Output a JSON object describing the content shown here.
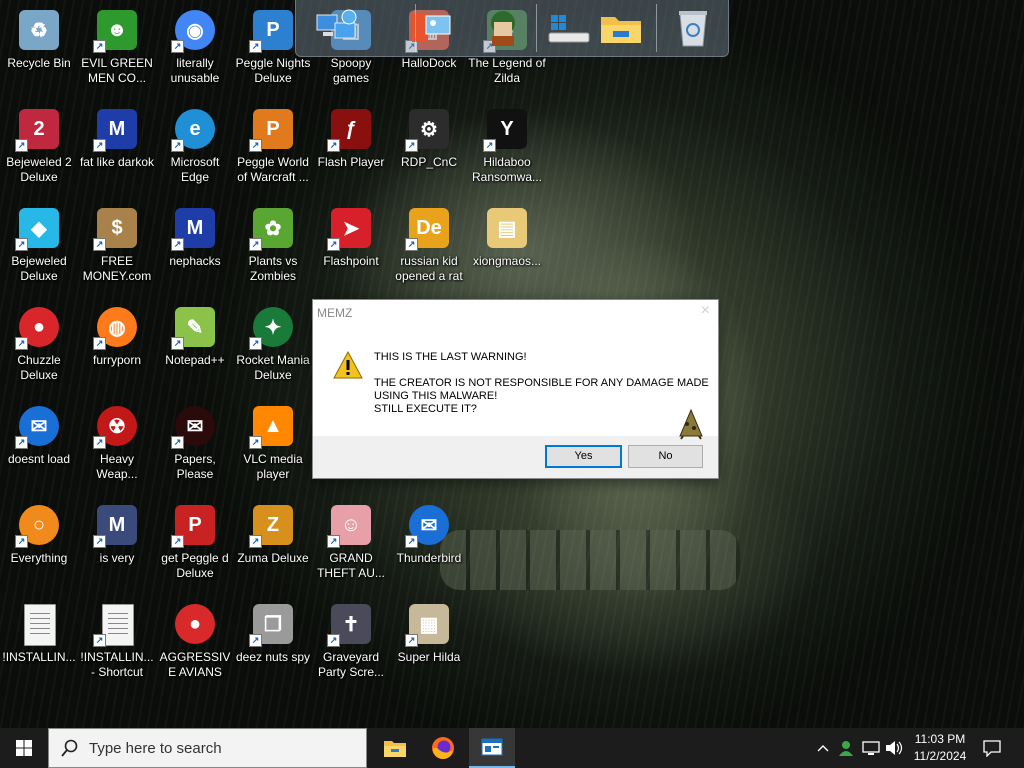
{
  "desktop_icons": [
    {
      "label": "Recycle Bin",
      "icon": "recycle-bin-icon",
      "shortcut": false,
      "color": "#7aa6c8"
    },
    {
      "label": "EVIL GREEN MEN CO...",
      "icon": "green-people-icon",
      "shortcut": true,
      "color": "#2e9a2e"
    },
    {
      "label": "literally unusable",
      "icon": "chrome-icon",
      "shortcut": true,
      "color": "#4285f4"
    },
    {
      "label": "Peggle Nights Deluxe",
      "icon": "peggle-icon",
      "shortcut": true,
      "color": "#2d7fd0"
    },
    {
      "label": "Spoopy games",
      "icon": "network-computers-icon",
      "shortcut": false,
      "color": "#3c8fd8"
    },
    {
      "label": "HalloDock",
      "icon": "hallodock-icon",
      "shortcut": true,
      "color": "#e04a2a"
    },
    {
      "label": "The Legend of Zilda",
      "icon": "zilda-icon",
      "shortcut": true,
      "color": "#3f7a3a"
    },
    {
      "label": "Bejeweled 2 Deluxe",
      "icon": "bejeweled-2-icon",
      "shortcut": true,
      "color": "#c02840"
    },
    {
      "label": "fat like darkok",
      "icon": "mpi-icon",
      "shortcut": true,
      "color": "#1e3da8"
    },
    {
      "label": "Microsoft Edge",
      "icon": "edge-icon",
      "shortcut": true,
      "color": "#1f8fd6"
    },
    {
      "label": "Peggle World of Warcraft ...",
      "icon": "peggle-icon",
      "shortcut": true,
      "color": "#e07a1c"
    },
    {
      "label": "Flash Player",
      "icon": "flash-icon",
      "shortcut": true,
      "color": "#8a0f0f"
    },
    {
      "label": "RDP_CnC",
      "icon": "rdp-icon",
      "shortcut": true,
      "color": "#2c2c2c"
    },
    {
      "label": "Hildaboo Ransomwa...",
      "icon": "yashma-icon",
      "shortcut": true,
      "color": "#111111"
    },
    {
      "label": "Bejeweled Deluxe",
      "icon": "gem-icon",
      "shortcut": true,
      "color": "#27b8e8"
    },
    {
      "label": "FREE MONEY.com",
      "icon": "money-bag-icon",
      "shortcut": true,
      "color": "#a8824a"
    },
    {
      "label": "nephacks",
      "icon": "mpi-icon",
      "shortcut": true,
      "color": "#1e3da8"
    },
    {
      "label": "Plants vs Zombies",
      "icon": "plant-icon",
      "shortcut": true,
      "color": "#5aa632"
    },
    {
      "label": "Flashpoint",
      "icon": "flashpoint-icon",
      "shortcut": true,
      "color": "#d8202a"
    },
    {
      "label": "russian kid opened a rat",
      "icon": "de-icon",
      "shortcut": true,
      "color": "#e8a21c"
    },
    {
      "label": "xiongmaos...",
      "icon": "folder-icon",
      "shortcut": false,
      "color": "#e8c978"
    },
    {
      "label": "Chuzzle Deluxe",
      "icon": "chuzzle-icon",
      "shortcut": true,
      "color": "#d8262a"
    },
    {
      "label": "furryporn",
      "icon": "firefox-icon",
      "shortcut": true,
      "color": "#ff7a1a"
    },
    {
      "label": "Notepad++",
      "icon": "notepad-plus-icon",
      "shortcut": true,
      "color": "#8bc34a"
    },
    {
      "label": "Rocket Mania Deluxe",
      "icon": "rocket-icon",
      "shortcut": true,
      "color": "#1a7a3a"
    },
    {
      "label": "doesnt load",
      "icon": "thunderbird-icon",
      "shortcut": true,
      "color": "#1a6fd6"
    },
    {
      "label": "Heavy Weap...",
      "icon": "radiation-icon",
      "shortcut": true,
      "color": "#c21818"
    },
    {
      "label": "Papers, Please",
      "icon": "papers-please-icon",
      "shortcut": true,
      "color": "#2a0a0a"
    },
    {
      "label": "VLC media player",
      "icon": "vlc-icon",
      "shortcut": true,
      "color": "#ff8800"
    },
    {
      "label": "Everything",
      "icon": "everything-icon",
      "shortcut": true,
      "color": "#f08a1c"
    },
    {
      "label": "is very",
      "icon": "mpi-shield-icon",
      "shortcut": true,
      "color": "#3a4a7a"
    },
    {
      "label": "get Peggle d Deluxe",
      "icon": "peggle-icon",
      "shortcut": true,
      "color": "#c82222"
    },
    {
      "label": "Zuma Deluxe",
      "icon": "zuma-icon",
      "shortcut": true,
      "color": "#d8901c"
    },
    {
      "label": "GRAND THEFT AU...",
      "icon": "anime-girl-icon",
      "shortcut": true,
      "color": "#e8a0a8"
    },
    {
      "label": "Thunderbird",
      "icon": "thunderbird-icon",
      "shortcut": true,
      "color": "#1a6fd6"
    },
    {
      "label": "!INSTALLIN...",
      "icon": "text-file-icon",
      "shortcut": false,
      "color": "#f4f4f4"
    },
    {
      "label": "!INSTALLIN... - Shortcut",
      "icon": "text-file-icon",
      "shortcut": true,
      "color": "#f4f4f4"
    },
    {
      "label": "AGGRESSIVE AVIANS",
      "icon": "angry-bird-icon",
      "shortcut": false,
      "color": "#d82a2a"
    },
    {
      "label": "deez nuts spy",
      "icon": "stacked-windows-icon",
      "shortcut": true,
      "color": "#9a9a9a"
    },
    {
      "label": "Graveyard Party Scre...",
      "icon": "graveyard-icon",
      "shortcut": true,
      "color": "#4a4a5a"
    },
    {
      "label": "Super Hilda",
      "icon": "hilda-pixel-icon",
      "shortcut": true,
      "color": "#c8b89a"
    }
  ],
  "top_dock": {
    "items": [
      {
        "name": "network-computers-icon"
      },
      {
        "name": "hallodock-window-icon"
      },
      {
        "name": "zilda-icon"
      },
      {
        "name": "windows-drive-icon"
      },
      {
        "name": "file-explorer-icon"
      },
      {
        "name": "recycle-bin-icon"
      }
    ]
  },
  "dialog": {
    "title": "MEMZ",
    "close_glyph": "×",
    "lines": [
      "THIS IS THE LAST WARNING!",
      "",
      "THE CREATOR IS NOT RESPONSIBLE FOR ANY DAMAGE MADE",
      "USING THIS MALWARE!",
      "STILL EXECUTE IT?"
    ],
    "yes_label": "Yes",
    "no_label": "No"
  },
  "taskbar": {
    "search_placeholder": "Type here to search",
    "apps": [
      {
        "name": "file-explorer-icon",
        "active": false
      },
      {
        "name": "firefox-icon",
        "active": false
      },
      {
        "name": "message-box-app-icon",
        "active": true
      }
    ],
    "tray": {
      "time": "11:03 PM",
      "date": "11/2/2024"
    }
  }
}
